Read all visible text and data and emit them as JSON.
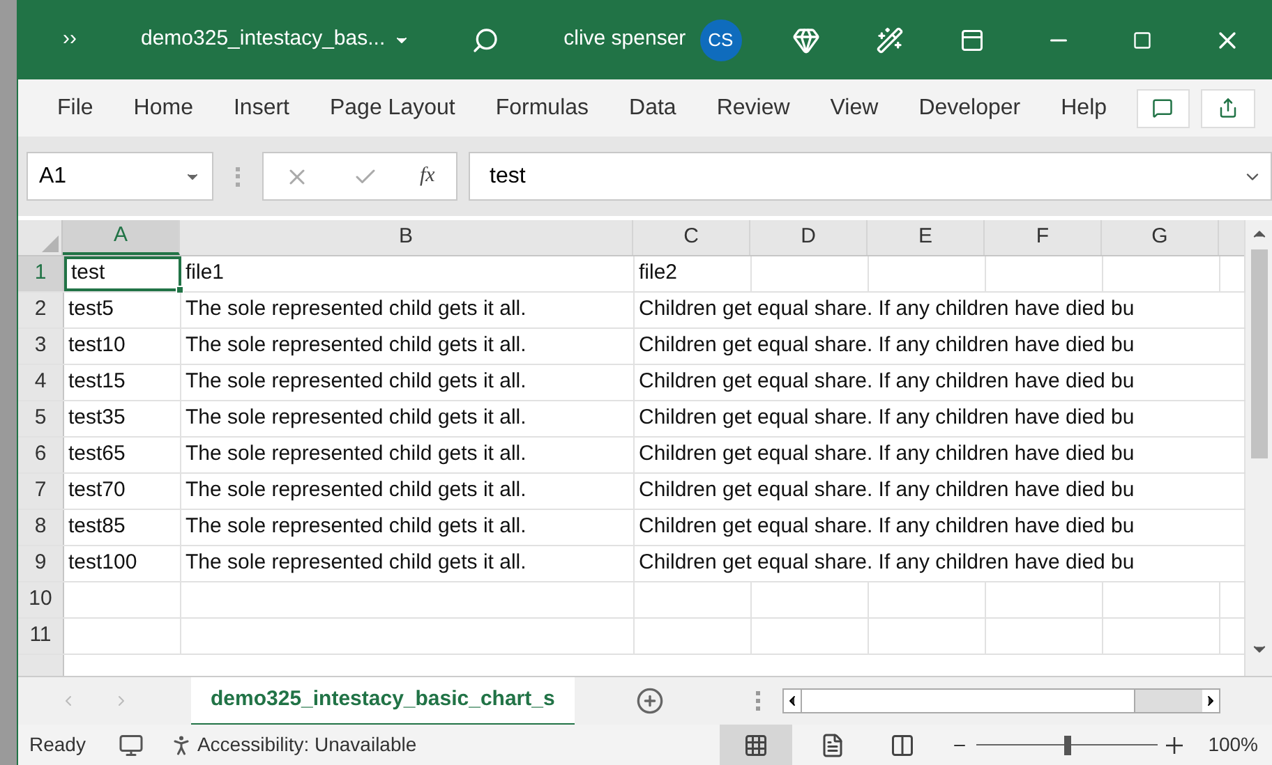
{
  "title_bar": {
    "quick_access": "››",
    "file_name": "demo325_intestacy_bas...",
    "user_name": "clive spenser",
    "user_initials": "CS"
  },
  "menu": [
    {
      "label": "File",
      "selected": false
    },
    {
      "label": "Home",
      "selected": false
    },
    {
      "label": "Insert",
      "selected": false
    },
    {
      "label": "Page Layout",
      "selected": false
    },
    {
      "label": "Formulas",
      "selected": false
    },
    {
      "label": "Data",
      "selected": false
    },
    {
      "label": "Review",
      "selected": false
    },
    {
      "label": "View",
      "selected": false
    },
    {
      "label": "Developer",
      "selected": false
    },
    {
      "label": "Help",
      "selected": false
    }
  ],
  "formula_bar": {
    "name_box": "A1",
    "fx": "fx",
    "value": "test"
  },
  "columns": [
    {
      "label": "A",
      "selected": true
    },
    {
      "label": "B",
      "selected": false
    },
    {
      "label": "C",
      "selected": false
    },
    {
      "label": "D",
      "selected": false
    },
    {
      "label": "E",
      "selected": false
    },
    {
      "label": "F",
      "selected": false
    },
    {
      "label": "G",
      "selected": false
    }
  ],
  "rows": [
    {
      "number": "1",
      "selected": true,
      "cells": [
        "test",
        "file1",
        "file2"
      ]
    },
    {
      "number": "2",
      "selected": false,
      "cells": [
        "test5",
        "The sole represented child gets it all.",
        "Children get equal share. If any children have died bu"
      ]
    },
    {
      "number": "3",
      "selected": false,
      "cells": [
        "test10",
        "The sole represented child gets it all.",
        "Children get equal share. If any children have died bu"
      ]
    },
    {
      "number": "4",
      "selected": false,
      "cells": [
        "test15",
        "The sole represented child gets it all.",
        "Children get equal share. If any children have died bu"
      ]
    },
    {
      "number": "5",
      "selected": false,
      "cells": [
        "test35",
        "The sole represented child gets it all.",
        "Children get equal share. If any children have died bu"
      ]
    },
    {
      "number": "6",
      "selected": false,
      "cells": [
        "test65",
        "The sole represented child gets it all.",
        "Children get equal share. If any children have died bu"
      ]
    },
    {
      "number": "7",
      "selected": false,
      "cells": [
        "test70",
        "The sole represented child gets it all.",
        "Children get equal share. If any children have died bu"
      ]
    },
    {
      "number": "8",
      "selected": false,
      "cells": [
        "test85",
        "The sole represented child gets it all.",
        "Children get equal share. If any children have died bu"
      ]
    },
    {
      "number": "9",
      "selected": false,
      "cells": [
        "test100",
        "The sole represented child gets it all.",
        "Children get equal share. If any children have died bu"
      ]
    },
    {
      "number": "10",
      "selected": false,
      "cells": []
    },
    {
      "number": "11",
      "selected": false,
      "cells": []
    }
  ],
  "sheet_tabs": [
    {
      "label": "demo325_intestacy_basic_chart_s",
      "selected": true
    }
  ],
  "status_bar": {
    "status": "Ready",
    "accessibility": "Accessibility: Unavailable",
    "zoom": "100%",
    "zoom_slider": {
      "level": 0.5
    }
  }
}
